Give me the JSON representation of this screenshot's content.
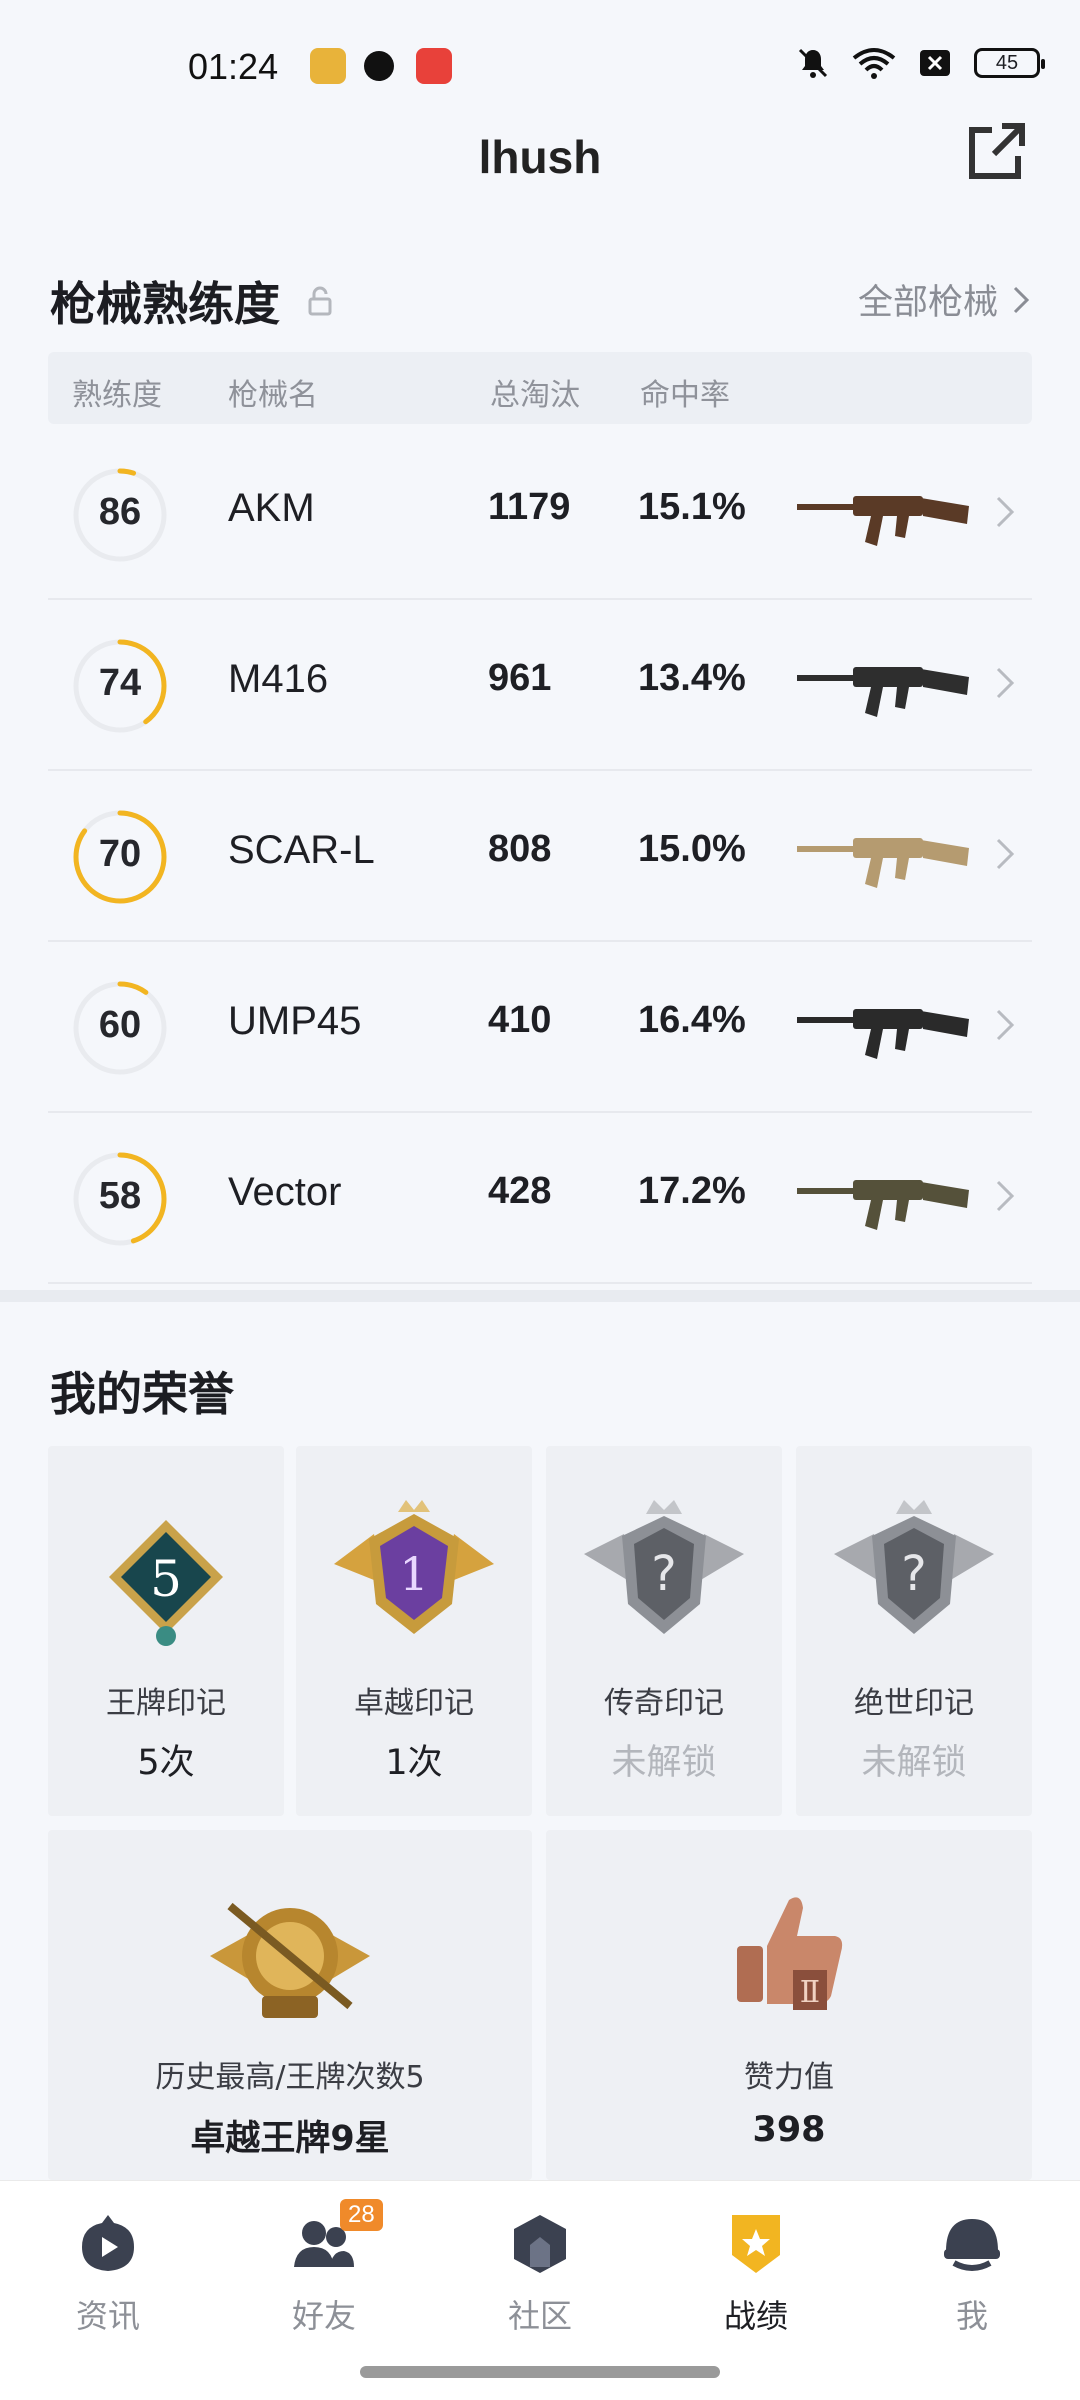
{
  "status": {
    "time": "01:24",
    "battery": "45"
  },
  "header": {
    "title": "lhush"
  },
  "weapons_section": {
    "title": "枪械熟练度",
    "all_link": "全部枪械",
    "columns": [
      "熟练度",
      "枪械名",
      "总淘汰",
      "命中率"
    ],
    "rows": [
      {
        "level": "86",
        "progress": 0.05,
        "name": "AKM",
        "kills": "1179",
        "accuracy": "15.1%"
      },
      {
        "level": "74",
        "progress": 0.4,
        "name": "M416",
        "kills": "961",
        "accuracy": "13.4%"
      },
      {
        "level": "70",
        "progress": 0.85,
        "name": "SCAR-L",
        "kills": "808",
        "accuracy": "15.0%"
      },
      {
        "level": "60",
        "progress": 0.1,
        "name": "UMP45",
        "kills": "410",
        "accuracy": "16.4%"
      },
      {
        "level": "58",
        "progress": 0.45,
        "name": "Vector",
        "kills": "428",
        "accuracy": "17.2%"
      }
    ]
  },
  "honors_section": {
    "title": "我的荣誉",
    "badges": [
      {
        "name": "王牌印记",
        "value": "5次",
        "locked": false,
        "emblem_text": "5"
      },
      {
        "name": "卓越印记",
        "value": "1次",
        "locked": false,
        "emblem_text": "1"
      },
      {
        "name": "传奇印记",
        "value": "未解锁",
        "locked": true,
        "emblem_text": "?"
      },
      {
        "name": "绝世印记",
        "value": "未解锁",
        "locked": true,
        "emblem_text": "?"
      }
    ],
    "highest": {
      "label": "历史最高/王牌次数5",
      "value": "卓越王牌9星"
    },
    "likes": {
      "label": "赞力值",
      "value": "398"
    }
  },
  "tabbar": {
    "tabs": [
      {
        "label": "资讯",
        "icon": "news-icon"
      },
      {
        "label": "好友",
        "icon": "friends-icon",
        "badge": "28"
      },
      {
        "label": "社区",
        "icon": "community-icon"
      },
      {
        "label": "战绩",
        "icon": "record-icon",
        "active": true
      },
      {
        "label": "我",
        "icon": "profile-icon"
      }
    ]
  },
  "colors": {
    "accent": "#f2b521",
    "text": "#1e1f24",
    "muted": "#8a8d95"
  }
}
